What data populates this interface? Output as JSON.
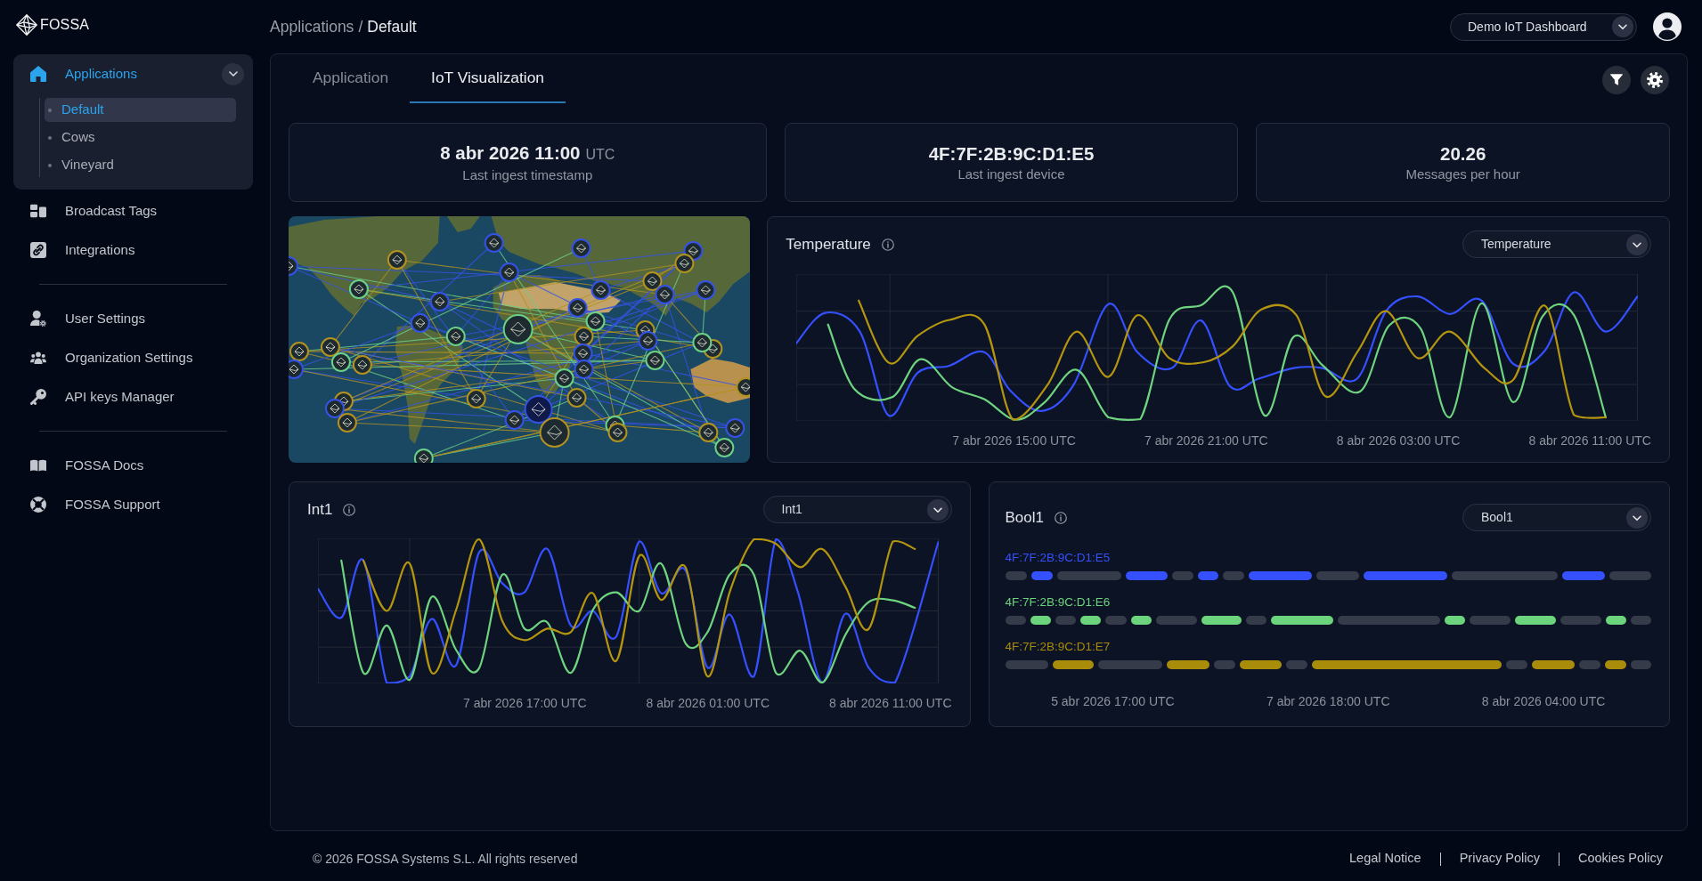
{
  "brand": {
    "name": "FOSSA"
  },
  "sidebar": {
    "sections": [
      {
        "items": [
          {
            "label": "Applications",
            "selected": true,
            "expanded": true,
            "children": [
              {
                "label": "Default",
                "selected": true
              },
              {
                "label": "Cows",
                "selected": false
              },
              {
                "label": "Vineyard",
                "selected": false
              }
            ]
          },
          {
            "label": "Broadcast Tags",
            "selected": false
          },
          {
            "label": "Integrations",
            "selected": false
          }
        ]
      },
      {
        "items": [
          {
            "label": "User Settings",
            "selected": false
          },
          {
            "label": "Organization Settings",
            "selected": false
          },
          {
            "label": "API keys Manager",
            "selected": false
          }
        ]
      },
      {
        "items": [
          {
            "label": "FOSSA Docs",
            "selected": false
          },
          {
            "label": "FOSSA Support",
            "selected": false
          }
        ]
      }
    ]
  },
  "header": {
    "breadcrumb": {
      "items": [
        "Applications",
        "Default"
      ],
      "separator": "/"
    },
    "dashboard_select": {
      "value": "Demo IoT Dashboard"
    }
  },
  "tabs": [
    {
      "label": "Application",
      "selected": false
    },
    {
      "label": "IoT Visualization",
      "selected": true
    }
  ],
  "stats": [
    {
      "value": "8 abr 2026 11:00",
      "unit": "UTC",
      "label": "Last ingest timestamp"
    },
    {
      "value": "4F:7F:2B:9C:D1:E5",
      "label": "Last ingest device"
    },
    {
      "value": "20.26",
      "label": "Messages per hour"
    }
  ],
  "temperature_chart": {
    "title": "Temperature",
    "select": {
      "value": "Temperature"
    },
    "x_labels": [
      "7 abr 2026 15:00 UTC",
      "7 abr 2026 21:00 UTC",
      "8 abr 2026 03:00 UTC",
      "8 abr 2026 11:00 UTC"
    ]
  },
  "int_chart": {
    "title": "Int1",
    "select": {
      "value": "Int1"
    },
    "x_labels": [
      "7 abr 2026 17:00 UTC",
      "8 abr 2026 01:00 UTC",
      "8 abr 2026 11:00 UTC"
    ]
  },
  "bool_chart": {
    "title": "Bool1",
    "select": {
      "value": "Bool1"
    },
    "devices": [
      {
        "label": "4F:7F:2B:9C:D1:E5",
        "color": "#3450ff",
        "segments": [
          {
            "on": false
          },
          {
            "on": true
          },
          {
            "on": false
          },
          {
            "on": true
          },
          {
            "on": false
          },
          {
            "on": true
          },
          {
            "on": false
          },
          {
            "on": true
          },
          {
            "on": false
          },
          {
            "on": true
          },
          {
            "on": false
          },
          {
            "on": true
          },
          {
            "on": false
          }
        ]
      },
      {
        "label": "4F:7F:2B:9C:D1:E6",
        "color": "#6cd47c",
        "segments": [
          {
            "on": false
          },
          {
            "on": true
          },
          {
            "on": false
          },
          {
            "on": true
          },
          {
            "on": false
          },
          {
            "on": true
          },
          {
            "on": false
          },
          {
            "on": true
          },
          {
            "on": false
          },
          {
            "on": true
          },
          {
            "on": false
          },
          {
            "on": true
          },
          {
            "on": false
          },
          {
            "on": true
          },
          {
            "on": false
          },
          {
            "on": true
          },
          {
            "on": false
          }
        ]
      },
      {
        "label": "4F:7F:2B:9C:D1:E7",
        "color": "#a88c0a",
        "segments": [
          {
            "on": false
          },
          {
            "on": true
          },
          {
            "on": false
          },
          {
            "on": true
          },
          {
            "on": false
          },
          {
            "on": true
          },
          {
            "on": false
          },
          {
            "on": true
          },
          {
            "on": false
          },
          {
            "on": true
          },
          {
            "on": false
          },
          {
            "on": true
          },
          {
            "on": false
          }
        ]
      }
    ],
    "x_labels": [
      "5 abr 2026 17:00 UTC",
      "7 abr 2026 18:00 UTC",
      "8 abr 2026 04:00 UTC"
    ]
  },
  "footer": {
    "copyright": "© 2026 FOSSA Systems S.L. All rights reserved",
    "links": [
      "Legal Notice",
      "Privacy Policy",
      "Cookies Policy"
    ]
  }
}
